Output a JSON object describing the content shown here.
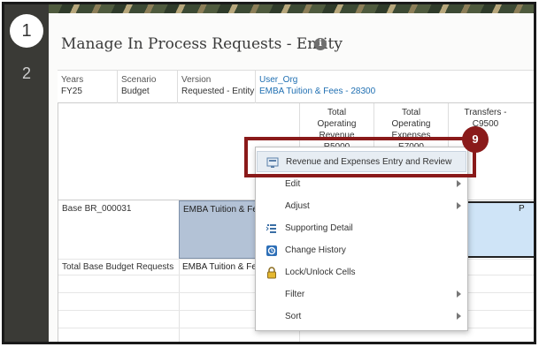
{
  "steps": {
    "current": "1",
    "next": "2"
  },
  "page": {
    "title": "Manage In Process Requests - Entity",
    "info_icon": "i"
  },
  "pov": [
    {
      "label": "Years",
      "value": "FY25"
    },
    {
      "label": "Scenario",
      "value": "Budget"
    },
    {
      "label": "Version",
      "value": "Requested - Entity"
    },
    {
      "label": "User_Org",
      "value": "EMBA Tuition & Fees - 28300"
    }
  ],
  "columns": [
    {
      "lines": [
        "Total",
        "Operating",
        "Revenue",
        "R5000"
      ]
    },
    {
      "lines": [
        "Total",
        "Operating",
        "Expenses",
        "E7000"
      ]
    },
    {
      "lines": [
        "Transfers -",
        "C9500"
      ]
    }
  ],
  "rows": [
    {
      "label": "Base BR_000031",
      "org": "EMBA Tuition & Fees - 28300"
    },
    {
      "label": "Total Base Budget Requests",
      "org": "EMBA Tuition & Fees - 28300"
    }
  ],
  "selected_cell_text": "P",
  "context_menu": {
    "items": [
      {
        "label": "Revenue and Expenses Entry and Review",
        "icon": "form-icon",
        "submenu": false,
        "highlighted": true
      },
      {
        "label": "Edit",
        "icon": "",
        "submenu": true
      },
      {
        "label": "Adjust",
        "icon": "",
        "submenu": true
      },
      {
        "label": "Supporting Detail",
        "icon": "supporting-detail-icon",
        "submenu": false
      },
      {
        "label": "Change History",
        "icon": "change-history-icon",
        "submenu": false
      },
      {
        "label": "Lock/Unlock Cells",
        "icon": "lock-icon",
        "submenu": false
      },
      {
        "label": "Filter",
        "icon": "",
        "submenu": true
      },
      {
        "label": "Sort",
        "icon": "",
        "submenu": true
      }
    ]
  },
  "callout": {
    "number": "9",
    "color": "#8a1a1a"
  },
  "colors": {
    "rail": "#3a3a36",
    "link": "#1f6fb2",
    "selected_row": "#b3c2d6",
    "selected_cell": "#cfe4f7"
  }
}
